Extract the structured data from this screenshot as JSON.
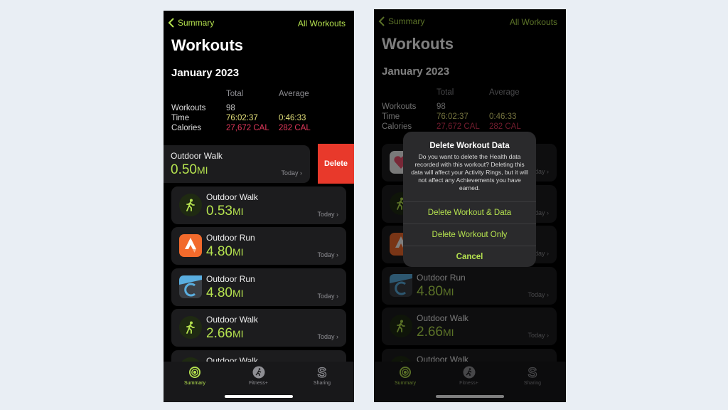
{
  "screen": {
    "nav": {
      "back_label": "Summary",
      "all_workouts_label": "All Workouts"
    },
    "title": "Workouts",
    "month": "January 2023",
    "stats": {
      "headers": {
        "total": "Total",
        "average": "Average"
      },
      "rows": [
        {
          "label": "Workouts",
          "total": "98",
          "average": "",
          "color": "#c8c8c8"
        },
        {
          "label": "Time",
          "total": "76:02:37",
          "average": "0:46:33",
          "color": "#e3e07a"
        },
        {
          "label": "Calories",
          "total": "27,672 CAL",
          "average": "282 CAL",
          "color": "#e0385a"
        }
      ]
    },
    "workouts": [
      {
        "name": "Outdoor Walk",
        "value": "0.50",
        "unit": "MI",
        "date": "Today",
        "icon": "health-app-icon"
      },
      {
        "name": "Outdoor Walk",
        "value": "0.53",
        "unit": "MI",
        "date": "Today",
        "icon": "walking-icon"
      },
      {
        "name": "Outdoor Run",
        "value": "4.80",
        "unit": "MI",
        "date": "Today",
        "icon": "strava-icon"
      },
      {
        "name": "Outdoor Run",
        "value": "4.80",
        "unit": "MI",
        "date": "Today",
        "icon": "garmin-icon"
      },
      {
        "name": "Outdoor Walk",
        "value": "2.66",
        "unit": "MI",
        "date": "Today",
        "icon": "walking-icon"
      },
      {
        "name": "Outdoor Walk",
        "value": "",
        "unit": "",
        "date": "",
        "icon": "walking-icon"
      }
    ],
    "delete_label": "Delete",
    "tabs": [
      {
        "label": "Summary",
        "icon": "activity-rings-icon",
        "active": true
      },
      {
        "label": "Fitness+",
        "icon": "fitness-plus-icon",
        "active": false
      },
      {
        "label": "Sharing",
        "icon": "sharing-icon",
        "active": false
      }
    ]
  },
  "alert": {
    "title": "Delete Workout Data",
    "message": "Do you want to delete the Health data recorded with this workout? Deleting this data will affect your Activity Rings, but it will not affect any Achievements you have earned.",
    "buttons": [
      "Delete Workout & Data",
      "Delete Workout Only",
      "Cancel"
    ]
  },
  "colors": {
    "accent": "#b5e24f",
    "delete": "#e8392b",
    "background": "#e9eef4"
  }
}
